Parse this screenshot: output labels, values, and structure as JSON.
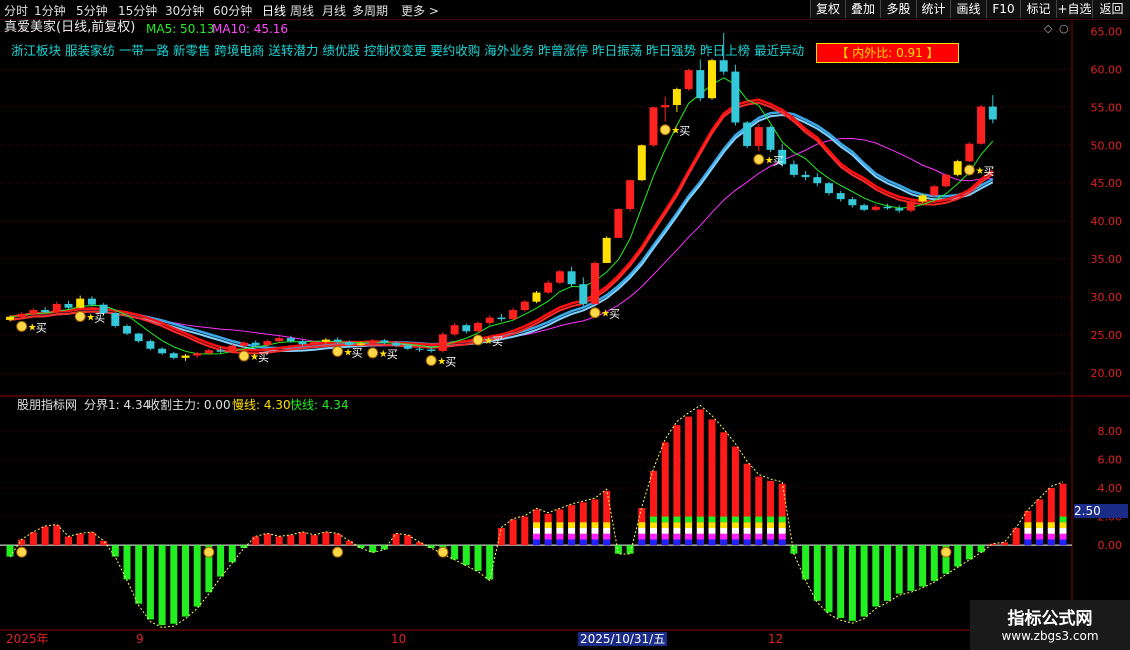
{
  "toolbar": {
    "periods": [
      "分时",
      "1分钟",
      "5分钟",
      "15分钟",
      "30分钟",
      "60分钟",
      "日线",
      "周线",
      "月线",
      "多周期",
      "更多 >"
    ],
    "buttons": [
      "复权",
      "叠加",
      "多股",
      "统计",
      "画线",
      "F10",
      "标记",
      "+自选",
      "返回"
    ]
  },
  "chart_header": {
    "stock": "真爱美家(日线,前复权)",
    "ma5_label": "MA5: 50.13",
    "ma10_label": "MA10: 45.16"
  },
  "concepts": "浙江板块 服装家纺 一带一路 新零售 跨境电商 送转潜力 绩优股 控制权变更 要约收购 海外业务 昨曾涨停 昨日振荡 昨日强势 昨日上榜 最近异动",
  "inner_outer": "【 内外比: 0.91 】",
  "indicator_header": {
    "name": "股朋指标网",
    "l1": "分界1: 4.34",
    "l2": "收割主力: 0.00",
    "l3": "慢线: 4.30",
    "l4": "快线: 4.34"
  },
  "price_axis": [
    "65.00",
    "60.00",
    "55.00",
    "50.00",
    "45.00",
    "40.00",
    "35.00",
    "30.00",
    "25.00",
    "20.00"
  ],
  "ind_axis": [
    "8.00",
    "6.00",
    "4.00",
    "2.00",
    "0.00"
  ],
  "ind_marker": "2.50",
  "date_labels": [
    "2025年",
    "9",
    "10",
    "12"
  ],
  "date_highlight": "2025/10/31/五",
  "buy_label": "买",
  "watermark": {
    "line1": "指标公式网",
    "line2": "www.zbgs3.com"
  },
  "colors": {
    "up": "#ff2020",
    "down": "#35c8d8",
    "up_yellow": "#ffe000",
    "grid": "#5a0000",
    "green": "#22ee22"
  },
  "chart_data": {
    "type": "candlestick",
    "candles": [
      [
        27.0,
        27.6,
        26.8,
        27.4
      ],
      [
        27.4,
        28.0,
        27.2,
        27.8
      ],
      [
        27.8,
        28.5,
        27.5,
        28.3
      ],
      [
        28.3,
        28.7,
        27.9,
        28.0
      ],
      [
        28.0,
        29.4,
        27.8,
        29.1
      ],
      [
        29.1,
        29.5,
        28.4,
        28.6
      ],
      [
        28.6,
        30.2,
        28.5,
        29.8
      ],
      [
        29.8,
        30.1,
        28.8,
        29.0
      ],
      [
        29.0,
        29.2,
        27.6,
        27.9
      ],
      [
        27.9,
        28.0,
        26.0,
        26.2
      ],
      [
        26.2,
        26.4,
        25.0,
        25.2
      ],
      [
        25.2,
        25.3,
        24.0,
        24.2
      ],
      [
        24.2,
        24.4,
        23.0,
        23.2
      ],
      [
        23.2,
        23.4,
        22.4,
        22.6
      ],
      [
        22.6,
        22.8,
        21.8,
        22.0
      ],
      [
        22.0,
        22.5,
        21.6,
        22.3
      ],
      [
        22.3,
        22.8,
        22.0,
        22.6
      ],
      [
        22.6,
        23.2,
        22.4,
        23.0
      ],
      [
        23.0,
        23.4,
        22.6,
        22.8
      ],
      [
        22.8,
        23.8,
        22.6,
        23.6
      ],
      [
        23.6,
        24.2,
        23.3,
        24.0
      ],
      [
        24.0,
        24.3,
        23.5,
        23.7
      ],
      [
        23.7,
        24.4,
        23.5,
        24.2
      ],
      [
        24.2,
        24.8,
        24.0,
        24.6
      ],
      [
        24.6,
        24.9,
        24.0,
        24.2
      ],
      [
        24.2,
        24.4,
        23.6,
        23.8
      ],
      [
        23.8,
        24.3,
        23.6,
        24.1
      ],
      [
        24.1,
        24.6,
        23.9,
        24.4
      ],
      [
        24.4,
        24.7,
        23.9,
        24.1
      ],
      [
        24.1,
        24.3,
        23.5,
        23.7
      ],
      [
        23.7,
        24.1,
        23.5,
        23.9
      ],
      [
        23.9,
        24.5,
        23.7,
        24.3
      ],
      [
        24.3,
        24.5,
        23.8,
        24.0
      ],
      [
        24.0,
        24.2,
        23.4,
        23.6
      ],
      [
        23.6,
        23.8,
        23.0,
        23.2
      ],
      [
        23.2,
        23.5,
        22.8,
        23.1
      ],
      [
        23.1,
        23.4,
        22.7,
        22.9
      ],
      [
        22.9,
        25.4,
        22.7,
        25.1
      ],
      [
        25.1,
        26.6,
        24.9,
        26.3
      ],
      [
        26.3,
        26.5,
        25.2,
        25.5
      ],
      [
        25.5,
        26.8,
        25.4,
        26.6
      ],
      [
        26.6,
        27.6,
        26.3,
        27.3
      ],
      [
        27.3,
        27.8,
        26.8,
        27.1
      ],
      [
        27.1,
        28.6,
        27.0,
        28.3
      ],
      [
        28.3,
        29.6,
        28.1,
        29.4
      ],
      [
        29.4,
        30.8,
        29.2,
        30.6
      ],
      [
        30.6,
        32.2,
        30.4,
        31.9
      ],
      [
        31.9,
        33.6,
        31.7,
        33.4
      ],
      [
        33.4,
        34.0,
        31.4,
        31.7
      ],
      [
        31.7,
        32.6,
        28.8,
        29.1
      ],
      [
        29.1,
        34.7,
        29.0,
        34.5
      ],
      [
        34.5,
        38.0,
        34.5,
        37.8
      ],
      [
        37.8,
        41.7,
        37.8,
        41.6
      ],
      [
        41.6,
        45.5,
        41.3,
        45.4
      ],
      [
        45.4,
        50.1,
        45.3,
        50.0
      ],
      [
        50.0,
        55.1,
        49.8,
        55.0
      ],
      [
        55.0,
        56.4,
        53.1,
        55.3
      ],
      [
        55.3,
        57.6,
        54.4,
        57.4
      ],
      [
        57.4,
        60.1,
        57.2,
        59.9
      ],
      [
        59.9,
        61.3,
        55.8,
        56.2
      ],
      [
        56.2,
        61.4,
        56.0,
        61.2
      ],
      [
        61.2,
        64.8,
        59.3,
        59.7
      ],
      [
        59.7,
        60.6,
        52.6,
        53.0
      ],
      [
        53.0,
        53.2,
        49.6,
        49.9
      ],
      [
        49.9,
        52.8,
        49.2,
        52.4
      ],
      [
        52.4,
        52.6,
        49.1,
        49.4
      ],
      [
        49.4,
        50.2,
        47.2,
        47.5
      ],
      [
        47.5,
        48.0,
        45.8,
        46.1
      ],
      [
        46.1,
        46.6,
        45.4,
        45.8
      ],
      [
        45.8,
        46.3,
        44.6,
        45.0
      ],
      [
        45.0,
        45.2,
        43.4,
        43.7
      ],
      [
        43.7,
        44.0,
        42.6,
        42.9
      ],
      [
        42.9,
        43.2,
        41.8,
        42.1
      ],
      [
        42.1,
        42.3,
        41.3,
        41.5
      ],
      [
        41.5,
        42.2,
        41.3,
        41.9
      ],
      [
        41.9,
        42.3,
        41.5,
        41.7
      ],
      [
        41.7,
        42.1,
        41.1,
        41.4
      ],
      [
        41.4,
        42.8,
        41.2,
        42.6
      ],
      [
        42.6,
        43.6,
        42.4,
        43.4
      ],
      [
        43.4,
        44.8,
        43.2,
        44.6
      ],
      [
        44.6,
        46.3,
        44.4,
        46.1
      ],
      [
        46.1,
        48.1,
        45.9,
        47.9
      ],
      [
        47.9,
        50.4,
        47.8,
        50.2
      ],
      [
        50.2,
        55.3,
        50.1,
        55.1
      ],
      [
        55.1,
        56.6,
        52.9,
        53.4
      ]
    ],
    "histogram": [
      -0.8,
      0.4,
      0.9,
      1.3,
      1.4,
      0.6,
      0.8,
      0.9,
      0.3,
      -0.8,
      -2.4,
      -4.1,
      -5.2,
      -5.6,
      -5.5,
      -5.0,
      -4.3,
      -3.3,
      -2.2,
      -1.2,
      -0.2,
      0.6,
      0.8,
      0.6,
      0.7,
      0.9,
      0.7,
      0.9,
      0.8,
      0.3,
      -0.2,
      -0.5,
      -0.3,
      0.8,
      0.7,
      0.2,
      -0.2,
      -0.6,
      -1.0,
      -1.4,
      -1.8,
      -2.4,
      1.2,
      1.8,
      2.0,
      2.5,
      2.2,
      2.5,
      2.8,
      3.0,
      3.2,
      3.8,
      -0.6,
      -0.6,
      2.6,
      5.2,
      7.2,
      8.4,
      9.0,
      9.5,
      8.8,
      7.9,
      6.9,
      5.7,
      4.8,
      4.5,
      4.3,
      -0.6,
      -2.4,
      -3.9,
      -4.7,
      -5.1,
      -5.3,
      -5.0,
      -4.3,
      -3.9,
      -3.4,
      -3.2,
      -2.9,
      -2.5,
      -2.0,
      -1.5,
      -1.0,
      -0.5,
      0.1,
      0.2,
      1.2,
      2.4,
      3.2,
      4.0,
      4.3
    ],
    "ylim_price": [
      17.5,
      66.5
    ],
    "ylim_ind": [
      -5.8,
      9.6
    ]
  }
}
